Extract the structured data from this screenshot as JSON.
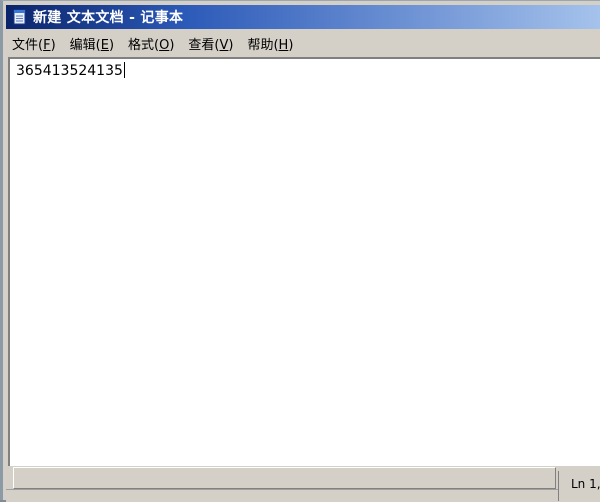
{
  "window": {
    "title": "新建 文本文档 - 记事本",
    "icon": "notepad-icon"
  },
  "menu": [
    {
      "label": "文件(",
      "key": "F",
      "tail": ")"
    },
    {
      "label": "编辑(",
      "key": "E",
      "tail": ")"
    },
    {
      "label": "格式(",
      "key": "O",
      "tail": ")"
    },
    {
      "label": "查看(",
      "key": "V",
      "tail": ")"
    },
    {
      "label": "帮助(",
      "key": "H",
      "tail": ")"
    }
  ],
  "editor": {
    "content": "365413524135"
  },
  "status": {
    "position": "Ln 1,"
  },
  "colors": {
    "title_start": "#0a246a",
    "title_end": "#a6c3ec",
    "chrome": "#d4d0c8"
  }
}
